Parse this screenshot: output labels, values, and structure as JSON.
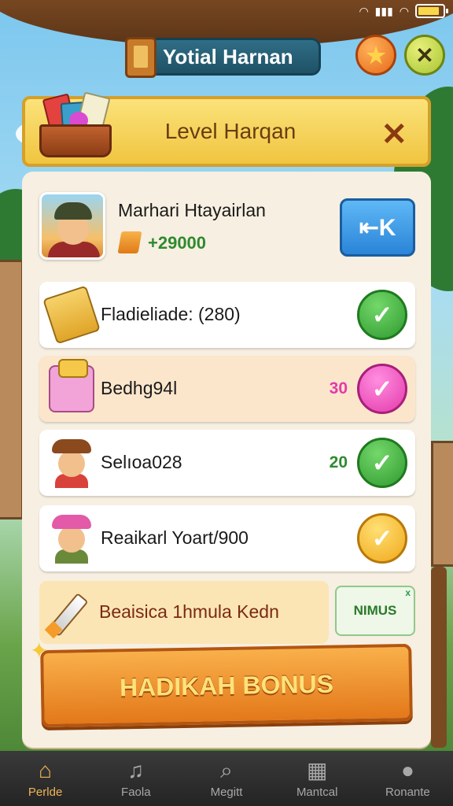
{
  "status_bar": {
    "icons": [
      "wifi-icon",
      "signal-icon",
      "wifi-icon",
      "battery-icon"
    ],
    "battery_level": 0.85
  },
  "header": {
    "title": "Yotial Harnan",
    "icons": [
      "book-icon",
      "star-icon",
      "close-icon"
    ],
    "star_glyph": "★",
    "close_glyph": "✕"
  },
  "banner": {
    "title": "Level Harqan",
    "close_glyph": "✕"
  },
  "profile": {
    "name": "Marhari Htayairlan",
    "points": "+29000",
    "share_glyph": "⇤K"
  },
  "tasks": [
    {
      "label": "Fladieliade: (280)",
      "count": "",
      "status": "green",
      "icon": "scroll-icon"
    },
    {
      "label": "Bedhg94l",
      "count": "30",
      "status": "pink",
      "icon": "gift-icon"
    },
    {
      "label": "Selıoa028",
      "count": "20",
      "status": "green",
      "icon": "person-icon"
    },
    {
      "label": "Reaikarl Yoart/900",
      "count": "",
      "status": "yellow",
      "icon": "person-icon"
    }
  ],
  "check_glyph": "✓",
  "bonus": {
    "label": "Beaisica 1hmula Kedn",
    "minus_label": "NIMUS",
    "minus_badge": "x"
  },
  "claim_button": "HADIKAH BONUS",
  "nav": [
    {
      "label": "Perlde",
      "icon": "home-icon",
      "glyph": "⌂",
      "active": true
    },
    {
      "label": "Faola",
      "icon": "music-icon",
      "glyph": "♫",
      "active": false
    },
    {
      "label": "Megitt",
      "icon": "search-icon",
      "glyph": "⌕",
      "active": false
    },
    {
      "label": "Mantcal",
      "icon": "grid-icon",
      "glyph": "▦",
      "active": false
    },
    {
      "label": "Ronante",
      "icon": "profile-icon",
      "glyph": "●",
      "active": false
    }
  ],
  "colors": {
    "accent_orange": "#e3781a",
    "nav_active": "#f1b454",
    "green": "#2f9a2f",
    "pink": "#e43aaa"
  }
}
